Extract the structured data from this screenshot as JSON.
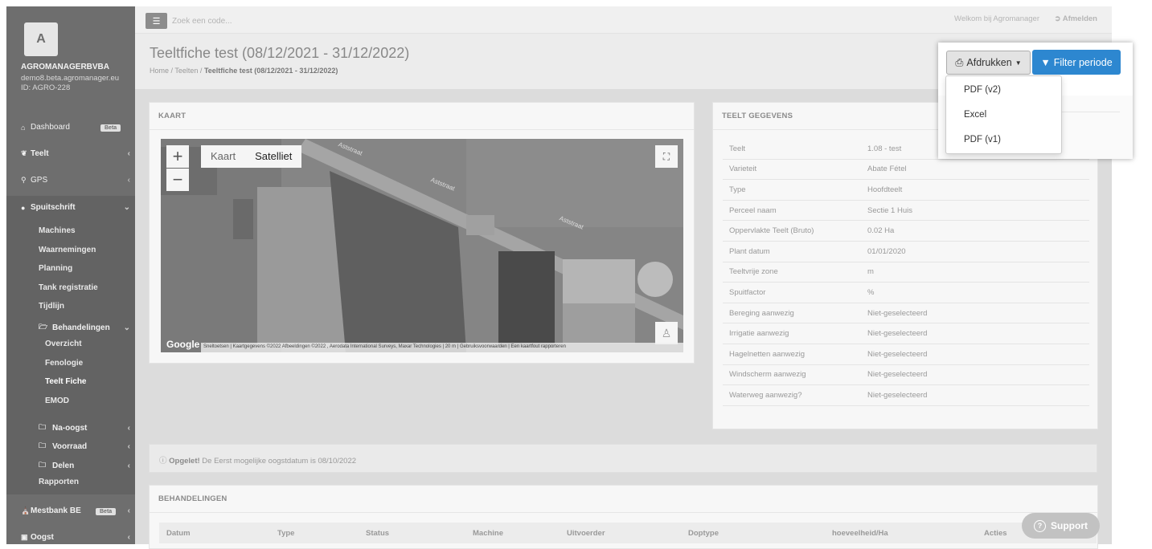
{
  "topbar": {
    "search_placeholder": "Zoek een code...",
    "welcome": "Welkom bij Agromanager",
    "logout": "Afmelden"
  },
  "sidebar": {
    "logo_letter": "A",
    "org_name": "AGROMANAGERBVBA",
    "org_url": "demo8.beta.agromanager.eu",
    "org_id": "ID: AGRO-228",
    "items": {
      "dashboard": "Dashboard",
      "dashboard_badge": "Beta",
      "teelt": "Teelt",
      "gps": "GPS",
      "spuitschrift": "Spuitschrift",
      "machines": "Machines",
      "waarnemingen": "Waarnemingen",
      "planning": "Planning",
      "tank": "Tank registratie",
      "tijdlijn": "Tijdlijn",
      "behandelingen": "Behandelingen",
      "overzicht": "Overzicht",
      "fenologie": "Fenologie",
      "teeltfiche": "Teelt Fiche",
      "emod": "EMOD",
      "naoogst": "Na-oogst",
      "voorraad": "Voorraad",
      "delen": "Delen",
      "rapporten": "Rapporten",
      "mestbank": "Mestbank BE",
      "mestbank_badge": "Beta",
      "oogst": "Oogst"
    }
  },
  "page": {
    "title": "Teeltfiche test (08/12/2021 - 31/12/2022)",
    "crumb_home": "Home",
    "crumb_teelten": "Teelten",
    "crumb_current": "Teeltfiche test (08/12/2021 - 31/12/2022)"
  },
  "map_panel": {
    "title": "KAART",
    "map_type_map": "Kaart",
    "map_type_sat": "Satelliet",
    "road_label": "Aststraat",
    "google": "Google",
    "attribution": "Sneltoetsen | Kaartgegevens ©2022 Afbeeldingen ©2022 , Aerodata International Surveys, Maxar Technologies | 20 m | Gebruiksvoorwaarden | Een kaartfout rapporteren"
  },
  "teelt_panel": {
    "title": "TEELT GEGEVENS",
    "rows": [
      {
        "k": "Teelt",
        "v": "1.08 - test"
      },
      {
        "k": "Varieteit",
        "v": "Abate Fétel"
      },
      {
        "k": "Type",
        "v": "Hoofdteelt"
      },
      {
        "k": "Perceel naam",
        "v": "Sectie 1 Huis"
      },
      {
        "k": "Oppervlakte Teelt (Bruto)",
        "v": "0.02 Ha"
      },
      {
        "k": "Plant datum",
        "v": "01/01/2020"
      },
      {
        "k": "Teeltvrije zone",
        "v": "m"
      },
      {
        "k": "Spuitfactor",
        "v": "%"
      },
      {
        "k": "Bereging aanwezig",
        "v": "Niet-geselecteerd"
      },
      {
        "k": "Irrigatie aanwezig",
        "v": "Niet-geselecteerd"
      },
      {
        "k": "Hagelnetten aanwezig",
        "v": "Niet-geselecteerd"
      },
      {
        "k": "Windscherm aanwezig",
        "v": "Niet-geselecteerd"
      },
      {
        "k": "Waterweg aanwezig?",
        "v": "Niet-geselecteerd"
      }
    ]
  },
  "alert": {
    "strong": "Opgelet!",
    "text": " De Eerst mogelijke oogstdatum is 08/10/2022"
  },
  "behandelingen": {
    "title": "BEHANDELINGEN",
    "columns": [
      "Datum",
      "Type",
      "Status",
      "Machine",
      "Uitvoerder",
      "Doptype",
      "hoeveelheid/Ha",
      "Acties"
    ]
  },
  "popup": {
    "print_label": "Afdrukken",
    "filter_label": "Filter periode",
    "options": [
      "PDF (v2)",
      "Excel",
      "PDF (v1)"
    ]
  },
  "support": {
    "label": "Support"
  }
}
